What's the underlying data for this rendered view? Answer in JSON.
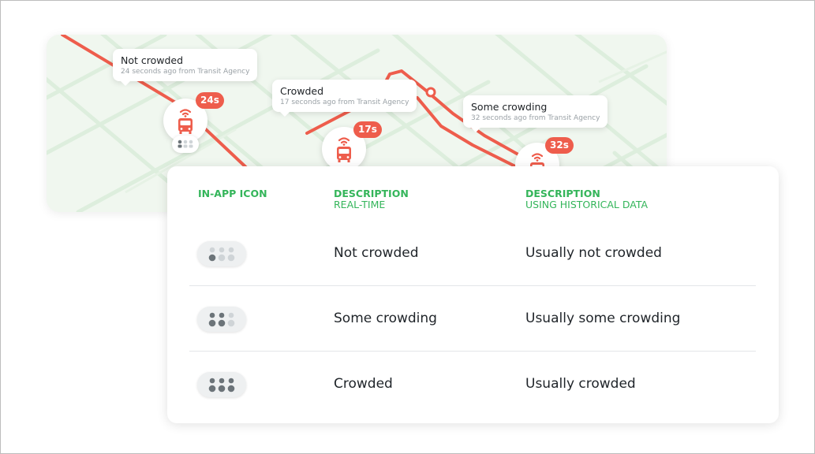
{
  "map": {
    "callouts": [
      {
        "title": "Not crowded",
        "subtitle": "24 seconds ago from Transit Agency",
        "badge": "24s"
      },
      {
        "title": "Crowded",
        "subtitle": "17 seconds ago from Transit Agency",
        "badge": "17s"
      },
      {
        "title": "Some crowding",
        "subtitle": "32 seconds ago from Transit Agency",
        "badge": "32s"
      }
    ],
    "route_color": "#ee5d4c",
    "map_bg_color": "#f0f7ef"
  },
  "table": {
    "headers": {
      "icon": "IN-APP ICON",
      "realtime_title": "DESCRIPTION",
      "realtime_sub": "REAL-TIME",
      "historical_title": "DESCRIPTION",
      "historical_sub": "USING HISTORICAL DATA"
    },
    "header_color": "#34b55a",
    "rows": [
      {
        "icon": "crowding-level-1-icon",
        "realtime": "Not crowded",
        "historical": "Usually not crowded"
      },
      {
        "icon": "crowding-level-2-icon",
        "realtime": "Some crowding",
        "historical": "Usually some crowding"
      },
      {
        "icon": "crowding-level-3-icon",
        "realtime": "Crowded",
        "historical": "Usually crowded"
      }
    ]
  }
}
